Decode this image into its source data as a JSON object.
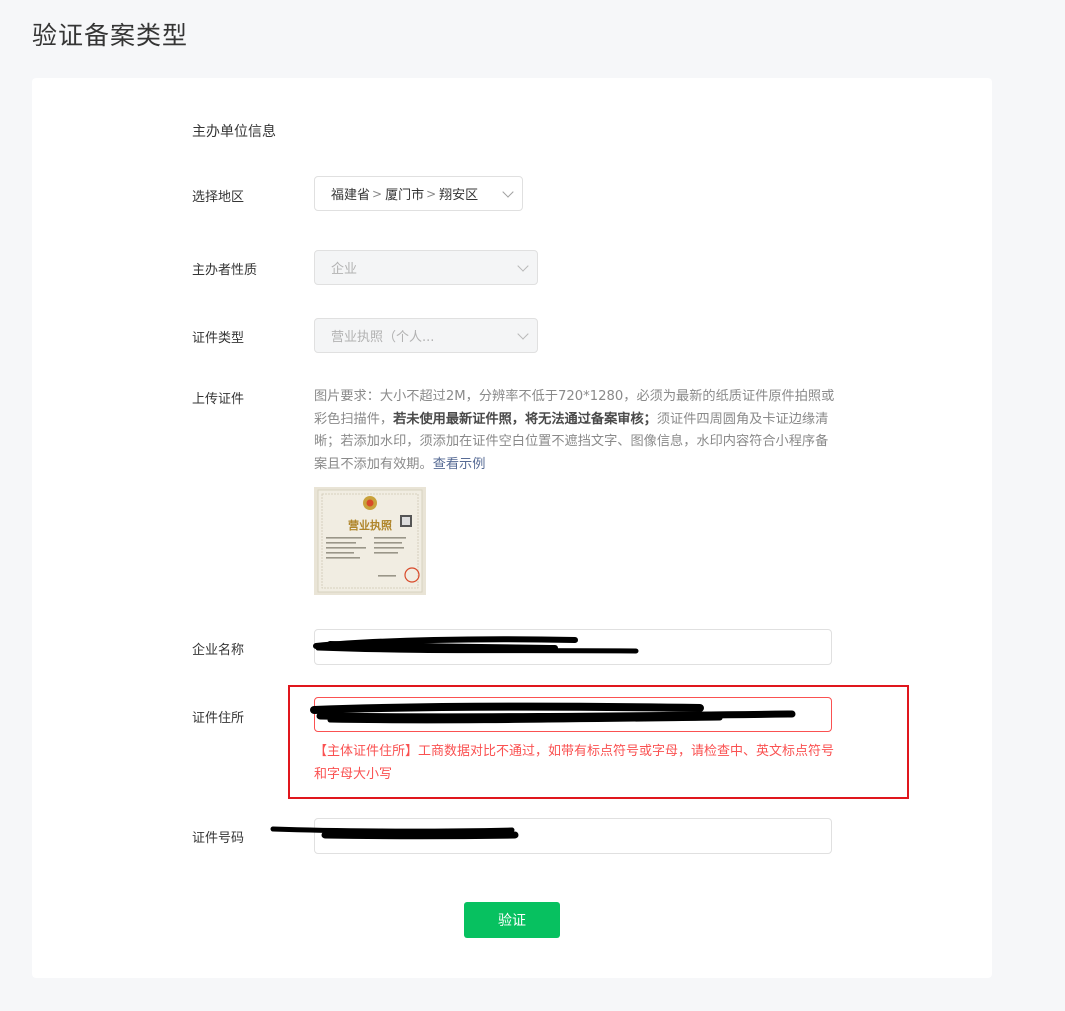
{
  "page_title": "验证备案类型",
  "section_title": "主办单位信息",
  "region": {
    "label": "选择地区",
    "province": "福建省",
    "city": "厦门市",
    "district": "翔安区",
    "separator": ">"
  },
  "host_nature": {
    "label": "主办者性质",
    "value": "企业"
  },
  "cert_type": {
    "label": "证件类型",
    "value": "营业执照（个人..."
  },
  "upload": {
    "label": "上传证件",
    "desc_part1": "图片要求：大小不超过2M，分辨率不低于720*1280，必须为最新的纸质证件原件拍照或彩色扫描件，",
    "desc_bold": "若未使用最新证件照，将无法通过备案审核；",
    "desc_part2": "须证件四周圆角及卡证边缘清晰；若添加水印，须添加在证件空白位置不遮挡文字、图像信息，水印内容符合小程序备案且不添加有效期。",
    "example_link": "查看示例",
    "thumbnail_title": "营业执照"
  },
  "company_name": {
    "label": "企业名称",
    "value": "",
    "redacted": true
  },
  "cert_address": {
    "label": "证件住所",
    "value": "",
    "redacted": true,
    "error": "【主体证件住所】工商数据对比不通过，如带有标点符号或字母，请检查中、英文标点符号和字母大小写"
  },
  "cert_number": {
    "label": "证件号码",
    "value": "",
    "redacted": true
  },
  "verify_button": "验证",
  "colors": {
    "primary_green": "#07c160",
    "error_red": "#fa5151",
    "highlight_red": "#e0161d",
    "link_blue": "#576b95",
    "page_bg": "#f6f7f9"
  }
}
